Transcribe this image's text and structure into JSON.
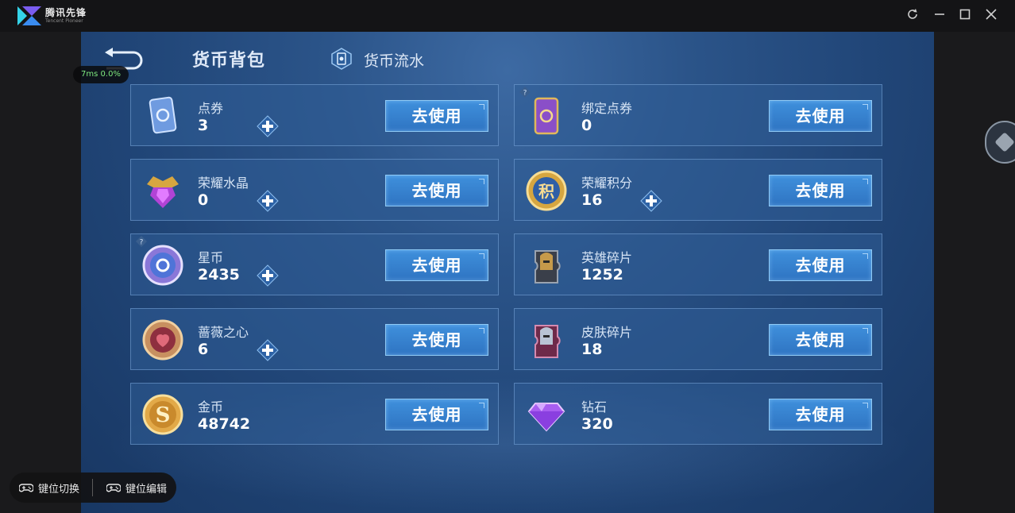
{
  "app": {
    "name": "腾讯先锋",
    "subtitle": "Tencent Pioneer",
    "window_buttons": [
      "refresh-icon",
      "minimize-icon",
      "maximize-icon",
      "close-icon"
    ]
  },
  "overlay": {
    "latency": "7ms  0.0%"
  },
  "header": {
    "title": "货币背包",
    "flow_label": "货币流水"
  },
  "cards": [
    {
      "name": "点券",
      "value": "3",
      "icon": "coupon-card-icon",
      "has_plus": true,
      "has_help": false,
      "button": "去使用"
    },
    {
      "name": "绑定点券",
      "value": "0",
      "icon": "bound-coupon-card-icon",
      "has_plus": false,
      "has_help": true,
      "button": "去使用"
    },
    {
      "name": "荣耀水晶",
      "value": "0",
      "icon": "glory-crystal-icon",
      "has_plus": true,
      "has_help": false,
      "button": "去使用"
    },
    {
      "name": "荣耀积分",
      "value": "16",
      "icon": "glory-points-icon",
      "has_plus": true,
      "has_help": false,
      "button": "去使用"
    },
    {
      "name": "星币",
      "value": "2435",
      "icon": "star-coin-icon",
      "has_plus": true,
      "has_help": true,
      "button": "去使用"
    },
    {
      "name": "英雄碎片",
      "value": "1252",
      "icon": "hero-fragment-icon",
      "has_plus": false,
      "has_help": false,
      "button": "去使用"
    },
    {
      "name": "蔷薇之心",
      "value": "6",
      "icon": "rose-heart-icon",
      "has_plus": true,
      "has_help": false,
      "button": "去使用"
    },
    {
      "name": "皮肤碎片",
      "value": "18",
      "icon": "skin-fragment-icon",
      "has_plus": false,
      "has_help": false,
      "button": "去使用"
    },
    {
      "name": "金币",
      "value": "48742",
      "icon": "gold-coin-icon",
      "has_plus": false,
      "has_help": false,
      "button": "去使用"
    },
    {
      "name": "钻石",
      "value": "320",
      "icon": "diamond-icon",
      "has_plus": false,
      "has_help": false,
      "button": "去使用"
    }
  ],
  "keybar": {
    "switch_label": "键位切换",
    "edit_label": "键位编辑"
  },
  "colors": {
    "button": "#3385d2",
    "card_bg": "#305c96",
    "panel_bg": "#214678"
  }
}
